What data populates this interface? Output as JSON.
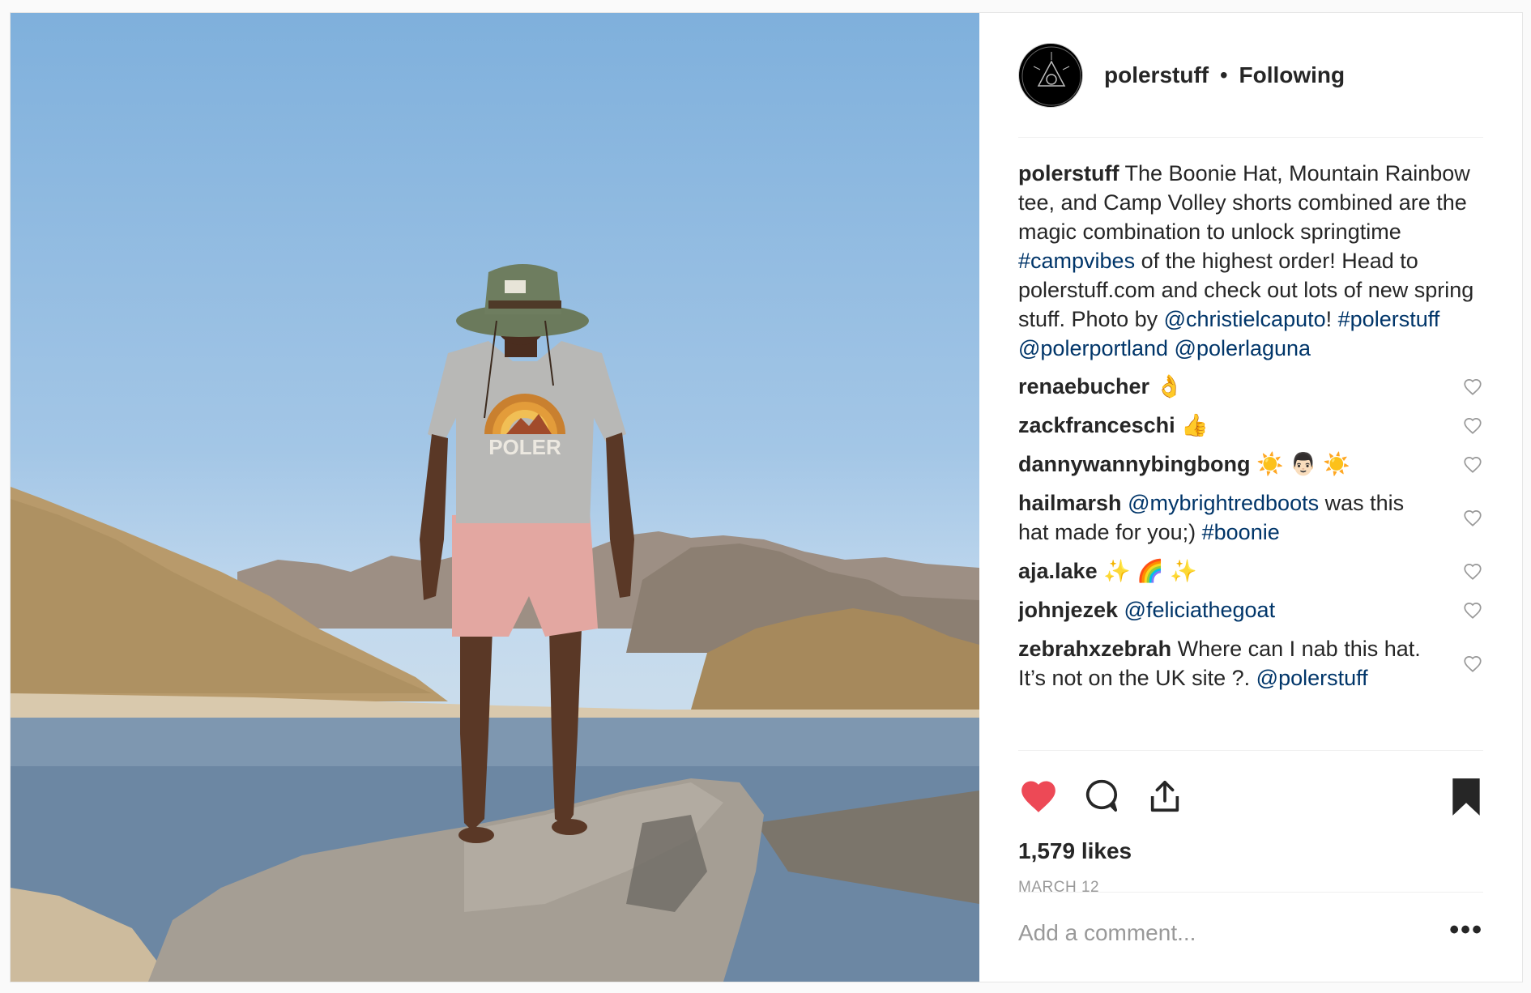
{
  "post": {
    "author": {
      "username": "polerstuff",
      "separator": "•",
      "follow_status": "Following"
    },
    "caption": {
      "username": "polerstuff",
      "parts": [
        {
          "text": " The Boonie Hat, Mountain Rainbow tee, and Camp Volley shorts combined are the magic combination to unlock springtime ",
          "link": false
        },
        {
          "text": "#campvibes",
          "link": true
        },
        {
          "text": " of the highest order! Head to polerstuff.com and check out lots of new spring stuff. Photo by ",
          "link": false
        },
        {
          "text": "@christielcaputo",
          "link": true
        },
        {
          "text": "! ",
          "link": false
        },
        {
          "text": "#polerstuff",
          "link": true
        },
        {
          "text": " ",
          "link": false
        },
        {
          "text": "@polerportland",
          "link": true
        },
        {
          "text": " ",
          "link": false
        },
        {
          "text": "@polerlaguna",
          "link": true
        }
      ]
    },
    "comments": [
      {
        "username": "renaebucher",
        "parts": [
          {
            "text": " 👌",
            "link": false
          }
        ]
      },
      {
        "username": "zackfranceschi",
        "parts": [
          {
            "text": " 👍",
            "link": false
          }
        ]
      },
      {
        "username": "dannywannybingbong",
        "parts": [
          {
            "text": " ☀️ 👨🏻 ☀️",
            "link": false
          }
        ]
      },
      {
        "username": "hailmarsh",
        "parts": [
          {
            "text": " ",
            "link": false
          },
          {
            "text": "@mybrightredboots",
            "link": true
          },
          {
            "text": " was this hat made for you;) ",
            "link": false
          },
          {
            "text": "#boonie",
            "link": true
          }
        ]
      },
      {
        "username": "aja.lake",
        "parts": [
          {
            "text": " ✨ 🌈 ✨",
            "link": false
          }
        ]
      },
      {
        "username": "johnjezek",
        "parts": [
          {
            "text": " ",
            "link": false
          },
          {
            "text": "@feliciathegoat",
            "link": true
          }
        ]
      },
      {
        "username": "zebrahxzebrah",
        "parts": [
          {
            "text": " Where can I nab this hat. It’s not on the UK site ?. ",
            "link": false
          },
          {
            "text": "@polerstuff",
            "link": true
          }
        ]
      }
    ],
    "likes_text": "1,579 likes",
    "date_text": "MARCH 12",
    "add_comment_placeholder": "Add a comment...",
    "more_label": "•••",
    "photo_shirt_text": "POLER",
    "icons": {
      "like": "heart-filled-icon",
      "comment": "comment-bubble-icon",
      "share": "share-upload-icon",
      "save": "bookmark-filled-icon",
      "comment_like": "heart-outline-icon"
    },
    "colors": {
      "like_red": "#ed4956",
      "link_blue": "#003569",
      "muted_gray": "#999999"
    }
  }
}
